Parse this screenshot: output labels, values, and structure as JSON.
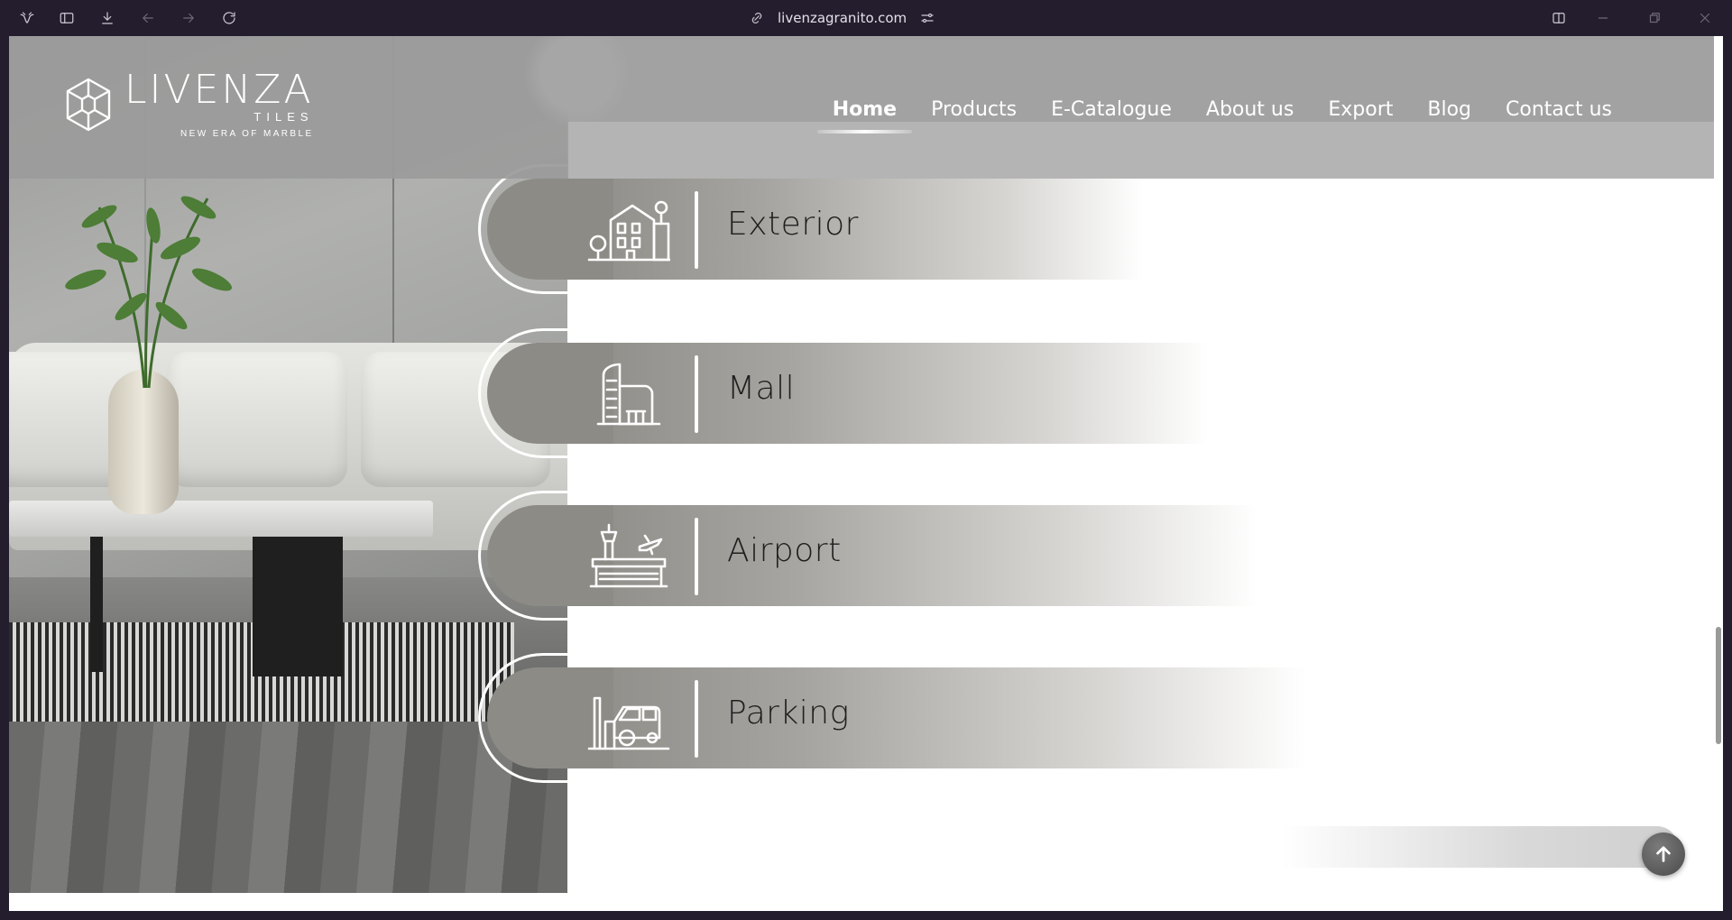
{
  "browser": {
    "url": "livenzagranito.com"
  },
  "site": {
    "logo": {
      "name": "LIVENZA",
      "sub": "TILES",
      "tagline": "NEW ERA OF MARBLE"
    },
    "nav": [
      {
        "label": "Home",
        "active": true
      },
      {
        "label": "Products",
        "active": false
      },
      {
        "label": "E-Catalogue",
        "active": false
      },
      {
        "label": "About us",
        "active": false
      },
      {
        "label": "Export",
        "active": false
      },
      {
        "label": "Blog",
        "active": false
      },
      {
        "label": "Contact us",
        "active": false
      }
    ]
  },
  "categories": [
    {
      "label": "Exterior",
      "icon": "building-icon"
    },
    {
      "label": "Mall",
      "icon": "mall-icon"
    },
    {
      "label": "Airport",
      "icon": "airport-icon"
    },
    {
      "label": "Parking",
      "icon": "parking-icon"
    }
  ],
  "colors": {
    "header_overlay": "#9b9b9b",
    "band_start": "#8d8b86",
    "band_end": "#ffffff",
    "chrome_bg": "#231d2d"
  }
}
